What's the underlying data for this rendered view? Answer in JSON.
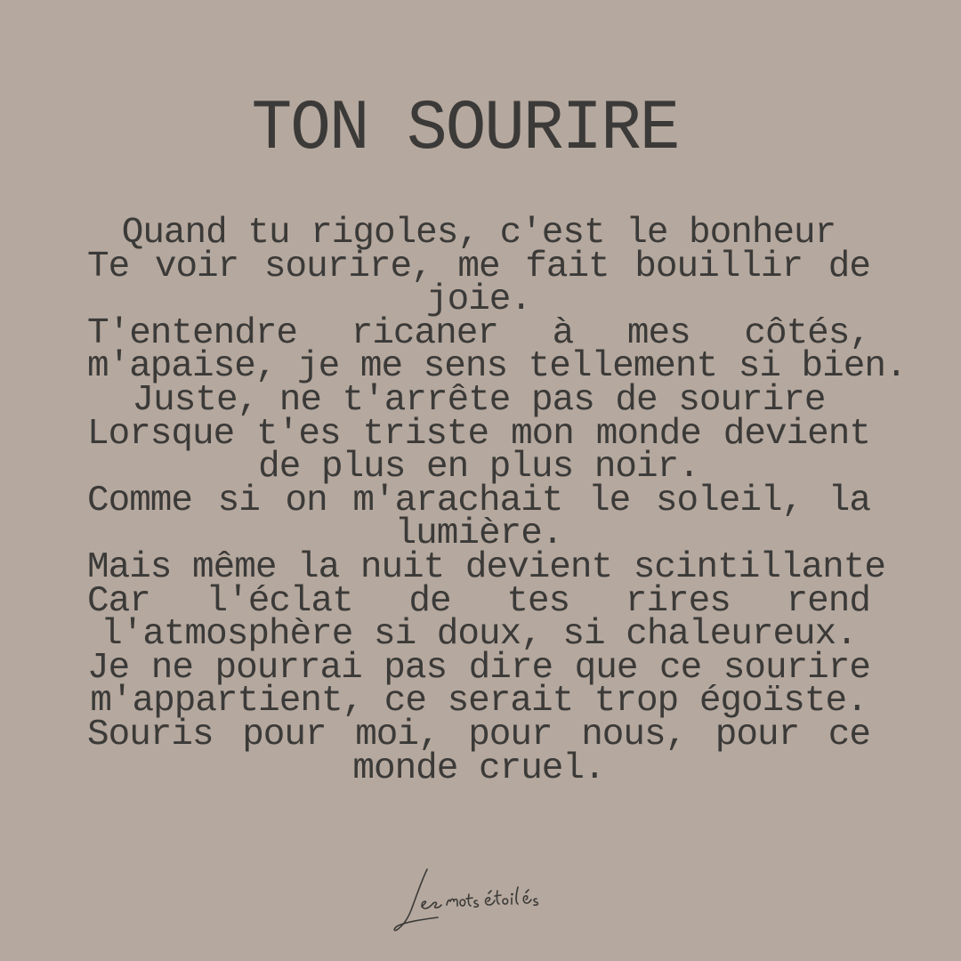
{
  "title": "TON SOURIRE",
  "poem": {
    "lines": [
      "Quand tu rigoles, c'est le bonheur",
      "Te voir sourire, me fait bouillir de",
      "joie.",
      "T'entendre ricaner à mes côtés,",
      "m'apaise, je me sens tellement si bien.",
      "Juste, ne t'arrête pas de sourire",
      "Lorsque t'es triste mon monde devient",
      "de plus en plus noir.",
      "Comme si on m'arachait le soleil, la",
      "lumière.",
      "Mais même la nuit devient scintillante",
      "Car l'éclat de tes rires rend",
      "l'atmosphère si doux, si chaleureux.",
      "Je ne pourrai pas dire que ce sourire",
      "m'appartient, ce serait trop égoïste.",
      "Souris pour moi, pour nous, pour ce",
      "monde cruel."
    ]
  },
  "signature": {
    "text": "Les mots étoilés"
  },
  "colors": {
    "background": "#b5a89e",
    "text": "#3b3a38"
  }
}
